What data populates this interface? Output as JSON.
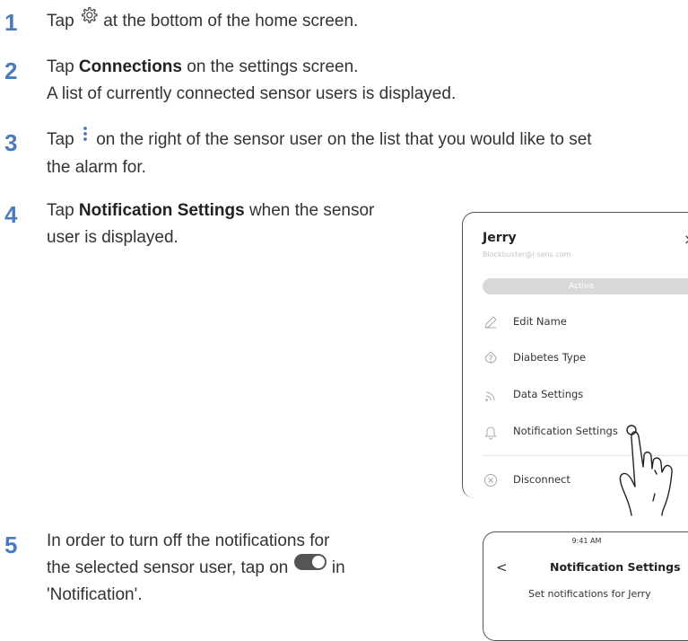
{
  "steps": [
    {
      "number": "1",
      "pre": "Tap",
      "icon": "gear-icon",
      "post": "at the bottom of the home screen."
    },
    {
      "number": "2",
      "pre": "Tap",
      "bold": "Connections",
      "post": "on the settings screen.",
      "line2": "A list of currently connected sensor users is displayed."
    },
    {
      "number": "3",
      "pre": "Tap",
      "icon": "more-vertical-icon",
      "post": "on the right of the sensor user on the list that you would like to set",
      "line2": "the alarm for."
    },
    {
      "number": "4",
      "pre": "Tap",
      "bold": "Notification Settings",
      "post": "when the sensor",
      "line2": "user is displayed."
    },
    {
      "number": "5",
      "line1": "In order to turn off the notifications for",
      "line2_pre": "the selected sensor user, tap on",
      "icon": "toggle-switch-icon",
      "line2_post": "in",
      "line3": "'Notification'."
    }
  ],
  "phone1": {
    "user_name": "Jerry",
    "user_email": "Blockbuster@i-sens.com",
    "close_glyph": "×",
    "status": "Active",
    "menu": [
      {
        "label": "Edit Name",
        "icon": "pencil-icon"
      },
      {
        "label": "Diabetes Type",
        "icon": "drop-icon"
      },
      {
        "label": "Data Settings",
        "icon": "signal-icon"
      },
      {
        "label": "Notification Settings",
        "icon": "bell-icon"
      },
      {
        "label": "Disconnect",
        "icon": "x-circle-icon"
      }
    ]
  },
  "phone2": {
    "time": "9:41 AM",
    "back_glyph": "<",
    "title": "Notification Settings",
    "subtitle": "Set notifications for Jerry"
  },
  "colors": {
    "step_number": "#4a7bbd",
    "active_pill": "#d9d9d9",
    "toggle": "#555555"
  }
}
